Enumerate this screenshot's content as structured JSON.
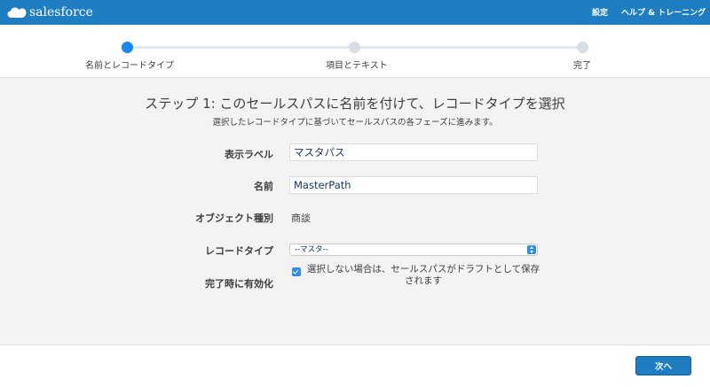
{
  "header": {
    "logo_text": "salesforce",
    "settings_link": "設定",
    "help_link": "ヘルプ & トレーニング",
    "background_color": "#1f7ec1"
  },
  "stepper": {
    "steps": [
      {
        "label": "名前とレコードタイプ",
        "state": "active"
      },
      {
        "label": "項目とテキスト",
        "state": "inactive"
      },
      {
        "label": "完了",
        "state": "inactive"
      }
    ],
    "active_color": "#1589ee",
    "inactive_color": "#d8dde6"
  },
  "main": {
    "title": "ステップ 1: このセールスパスに名前を付けて、レコードタイプを選択",
    "subtitle": "選択したレコードタイプに基づいてセールスパスの各フェーズに進みます。"
  },
  "form": {
    "display_label": {
      "label": "表示ラベル",
      "value": "マスタパス"
    },
    "name": {
      "label": "名前",
      "value": "MasterPath"
    },
    "object_type": {
      "label": "オブジェクト種別",
      "value": "商談"
    },
    "record_type": {
      "label": "レコードタイプ",
      "selected": "--マスタ--"
    },
    "active_on_complete": {
      "label": "完了時に有効化",
      "checked": true,
      "text": "選択しない場合は、セールスパスがドラフトとして保存されます"
    }
  },
  "footer": {
    "next_button": "次へ"
  }
}
